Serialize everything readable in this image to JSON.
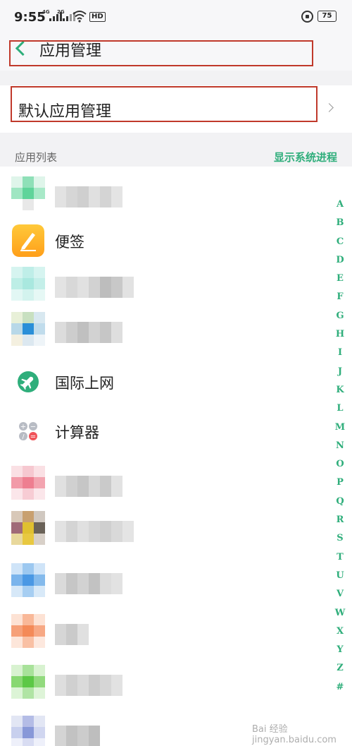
{
  "status_bar": {
    "time": "9:55",
    "signal1_tag": "4G",
    "signal2_tag": "2G",
    "hd_label": "HD",
    "battery": "75"
  },
  "header": {
    "title": "应用管理"
  },
  "default_apps": {
    "label": "默认应用管理"
  },
  "list_header": {
    "label": "应用列表",
    "show_system_link": "显示系统进程"
  },
  "apps": [
    {
      "name": "",
      "blurred": true,
      "icon": "blurred-icon"
    },
    {
      "name": "便签",
      "blurred": false,
      "icon": "notes-icon"
    },
    {
      "name": "",
      "blurred": true,
      "icon": "blurred-icon"
    },
    {
      "name": "",
      "blurred": true,
      "icon": "blurred-icon"
    },
    {
      "name": "国际上网",
      "blurred": false,
      "icon": "airplane-icon"
    },
    {
      "name": "计算器",
      "blurred": false,
      "icon": "calculator-icon"
    },
    {
      "name": "",
      "blurred": true,
      "icon": "blurred-icon"
    },
    {
      "name": "",
      "blurred": true,
      "icon": "blurred-icon"
    },
    {
      "name": "",
      "blurred": true,
      "icon": "blurred-icon"
    },
    {
      "name": "",
      "blurred": true,
      "icon": "blurred-icon"
    },
    {
      "name": "",
      "blurred": true,
      "icon": "blurred-icon"
    },
    {
      "name": "",
      "blurred": true,
      "icon": "blurred-icon"
    }
  ],
  "alphabet_index": [
    "A",
    "B",
    "C",
    "D",
    "E",
    "F",
    "G",
    "H",
    "I",
    "J",
    "K",
    "L",
    "M",
    "N",
    "O",
    "P",
    "Q",
    "R",
    "S",
    "T",
    "U",
    "V",
    "W",
    "X",
    "Y",
    "Z",
    "#"
  ],
  "colors": {
    "accent": "#2fae7b",
    "highlight_box": "#c0392b"
  },
  "watermark": "Bai 经验 jingyan.baidu.com"
}
